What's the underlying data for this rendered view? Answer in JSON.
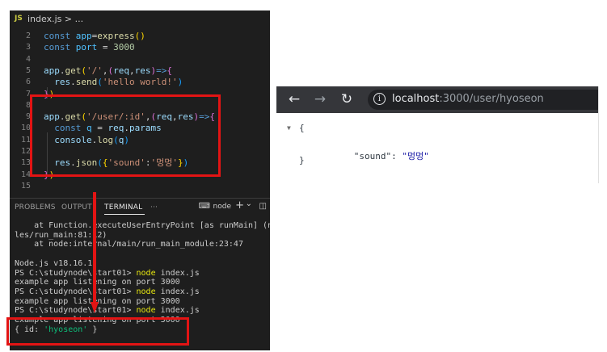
{
  "editor": {
    "tab": {
      "badge": "JS",
      "filename": "index.js >  ..."
    },
    "lines": [
      {
        "n": "2",
        "tokens": [
          [
            "kw",
            "const "
          ],
          [
            "var",
            "app"
          ],
          [
            "",
            "="
          ],
          [
            "fn",
            "express"
          ],
          [
            "br1",
            "()"
          ]
        ]
      },
      {
        "n": "3",
        "tokens": [
          [
            "kw",
            "const "
          ],
          [
            "var",
            "port"
          ],
          [
            "",
            " = "
          ],
          [
            "num",
            "3000"
          ]
        ]
      },
      {
        "n": "4",
        "tokens": []
      },
      {
        "n": "5",
        "tokens": [
          [
            "id",
            "app"
          ],
          [
            "",
            "."
          ],
          [
            "fn",
            "get"
          ],
          [
            "br1",
            "("
          ],
          [
            "str",
            "'/'"
          ],
          [
            "",
            ","
          ],
          [
            "br2",
            "("
          ],
          [
            "id",
            "req"
          ],
          [
            "",
            ","
          ],
          [
            "id",
            "res"
          ],
          [
            "br2",
            ")"
          ],
          [
            "kw",
            "=>"
          ],
          [
            "br2",
            "{"
          ]
        ]
      },
      {
        "n": "6",
        "tokens": [
          [
            "",
            "  "
          ],
          [
            "id",
            "res"
          ],
          [
            "",
            "."
          ],
          [
            "fn",
            "send"
          ],
          [
            "br3",
            "("
          ],
          [
            "str",
            "'hello world!'"
          ],
          [
            "br3",
            ")"
          ]
        ]
      },
      {
        "n": "7",
        "tokens": [
          [
            "br2",
            "}"
          ],
          [
            "br1",
            ")"
          ]
        ]
      },
      {
        "n": "8",
        "tokens": []
      },
      {
        "n": "9",
        "tokens": [
          [
            "id",
            "app"
          ],
          [
            "",
            "."
          ],
          [
            "fn",
            "get"
          ],
          [
            "br1",
            "("
          ],
          [
            "str",
            "'/user/:id'"
          ],
          [
            "",
            ","
          ],
          [
            "br2",
            "("
          ],
          [
            "id",
            "req"
          ],
          [
            "",
            ","
          ],
          [
            "id",
            "res"
          ],
          [
            "br2",
            ")"
          ],
          [
            "kw",
            "=>"
          ],
          [
            "br2",
            "{"
          ]
        ]
      },
      {
        "n": "10",
        "tokens": [
          [
            "",
            "  "
          ],
          [
            "kw",
            "const "
          ],
          [
            "var",
            "q"
          ],
          [
            "",
            " = "
          ],
          [
            "id",
            "req"
          ],
          [
            "",
            "."
          ],
          [
            "id",
            "params"
          ]
        ]
      },
      {
        "n": "11",
        "tokens": [
          [
            "",
            "  "
          ],
          [
            "id",
            "console"
          ],
          [
            "",
            "."
          ],
          [
            "fn",
            "log"
          ],
          [
            "br3",
            "("
          ],
          [
            "id",
            "q"
          ],
          [
            "br3",
            ")"
          ]
        ]
      },
      {
        "n": "12",
        "tokens": []
      },
      {
        "n": "13",
        "tokens": [
          [
            "",
            "  "
          ],
          [
            "id",
            "res"
          ],
          [
            "",
            "."
          ],
          [
            "fn",
            "json"
          ],
          [
            "br3",
            "("
          ],
          [
            "br1",
            "{"
          ],
          [
            "str",
            "'sound'"
          ],
          [
            "",
            ":"
          ],
          [
            "str",
            "'멍멍'"
          ],
          [
            "br1",
            "}"
          ],
          [
            "br3",
            ")"
          ]
        ]
      },
      {
        "n": "14",
        "tokens": [
          [
            "br2",
            "}"
          ],
          [
            "br1",
            ")"
          ]
        ]
      },
      {
        "n": "15",
        "tokens": []
      }
    ]
  },
  "panel": {
    "tabs": [
      "PROBLEMS",
      "OUTPUT",
      "TERMINAL",
      "···"
    ],
    "active_tab": "TERMINAL",
    "terminal_name": "node",
    "actions": {
      "add": "+",
      "dropdown": "⌄",
      "split": "◫"
    }
  },
  "terminal": {
    "lines": [
      [
        [
          "",
          "    at Function.executeUserEntryPoint [as runMain] (node:i"
        ]
      ],
      [
        [
          "",
          "les/run_main:81:12)"
        ]
      ],
      [
        [
          "",
          "    at node:internal/main/run_main_module:23:47"
        ]
      ],
      [
        [
          "",
          ""
        ]
      ],
      [
        [
          "",
          "Node.js v18.16.1"
        ]
      ],
      [
        [
          "",
          "PS C:\\studynode\\start01> "
        ],
        [
          "tcmd",
          "node"
        ],
        [
          "",
          " index.js"
        ]
      ],
      [
        [
          "",
          "example app listening on port 3000"
        ]
      ],
      [
        [
          "",
          "PS C:\\studynode\\start01> "
        ],
        [
          "tcmd",
          "node"
        ],
        [
          "",
          " index.js"
        ]
      ],
      [
        [
          "",
          "example app listening on port 3000"
        ]
      ],
      [
        [
          "",
          "PS C:\\studynode\\start01> "
        ],
        [
          "tcmd",
          "node"
        ],
        [
          "",
          " index.js"
        ]
      ],
      [
        [
          "",
          "example app listening on port 3000"
        ]
      ],
      [
        [
          "",
          "{ id: "
        ],
        [
          "tstr",
          "'hyoseon'"
        ],
        [
          "",
          " }"
        ]
      ]
    ]
  },
  "browser": {
    "url_host": "localhost",
    "url_path": ":3000/user/hyoseon",
    "back_icon": "←",
    "forward_icon": "→",
    "reload_icon": "↻",
    "info_icon": "i",
    "json": {
      "toggle": "▼",
      "open": "{",
      "key": "\"sound\"",
      "colon": ": ",
      "value": "\"멍멍\"",
      "close": "}"
    }
  },
  "colors": {
    "highlight_box": "#e31414",
    "editor_bg": "#1e1e1e",
    "browser_bar": "#35363a"
  }
}
